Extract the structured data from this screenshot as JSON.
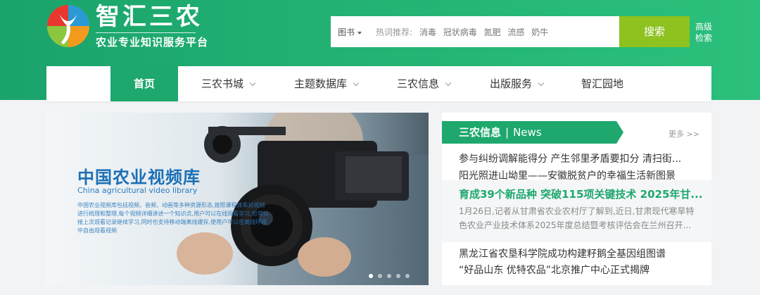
{
  "brand": {
    "name": "智汇三农",
    "subtitle": "农业专业知识服务平台"
  },
  "search": {
    "type_label": "图书",
    "hot_label": "热词推荐:",
    "hot_words": [
      "消毒",
      "冠状病毒",
      "氮肥",
      "流感",
      "奶牛"
    ],
    "button_label": "搜索",
    "advanced_label": "高级检索"
  },
  "nav": {
    "items": [
      {
        "label": "首页"
      },
      {
        "label": "三农书城"
      },
      {
        "label": "主题数据库"
      },
      {
        "label": "三农信息"
      },
      {
        "label": "出版服务"
      },
      {
        "label": "智汇园地"
      }
    ]
  },
  "banner": {
    "title": "中国农业视频库",
    "subtitle_en": "China agricultural video library",
    "description": "中国农业视频库包括视频、音频、动画等多种资源形态,按照课程体系对视频进行梳理和整理,每个视频详细讲述一个知识点,用户可以在线观看学习,也可以接上次观看记录继续学习,同时也支持移动端离线缓存,使用户可以在离线环境中自由观看视频",
    "slides": 5,
    "active_slide": 1
  },
  "news": {
    "tab_cn": "三农信息",
    "tab_sep": "|",
    "tab_en": "News",
    "more": "更多 >>",
    "items_top": [
      "参与纠纷调解能得分 产生邻里矛盾要扣分 清扫街...",
      "阳光照进山坳里——安徽脱贫户的幸福生活新图景"
    ],
    "highlight": {
      "title": "育成39个新品种 突破115项关键技术 2025年甘...",
      "text": "1月26日,记者从甘肃省农业农村厅了解到,近日,甘肃现代寒旱特色农业产业技术体系2025年度总结暨考核评估会在兰州召开..."
    },
    "items_bottom": [
      "黑龙江省农垦科学院成功构建籽鹅全基因组图谱",
      "“好品山东 优特农品”北京推广中心正式揭牌"
    ]
  },
  "colors": {
    "brand_green": "#1ea86e",
    "search_green": "#8dc21f",
    "banner_blue": "#1b6fb5"
  }
}
